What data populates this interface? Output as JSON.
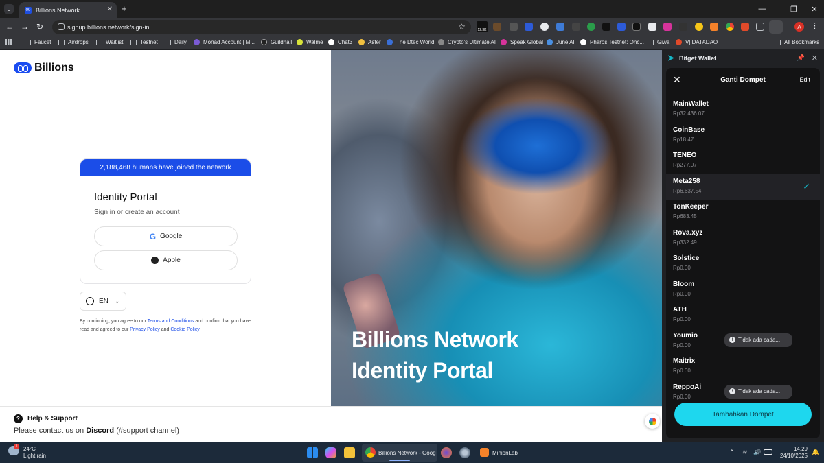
{
  "browser": {
    "tab": {
      "title": "Billions Network",
      "favicon": "00"
    },
    "url": "signup.billions.network/sign-in",
    "ext_badge": "12.3K",
    "profile_initial": "A",
    "bookmarks": [
      "Faucet",
      "Airdrops",
      "Waitlist",
      "Testnet",
      "Daily",
      "Monad Account | M...",
      "Guildhall",
      "Walme",
      "Chat3",
      "Aster",
      "The Dtec World",
      "Crypto's Ultimate AI",
      "Speak Global",
      "June AI",
      "Pharos Testnet: Onc...",
      "Giwa",
      "V| DATADAO"
    ],
    "all_bookmarks": "All Bookmarks"
  },
  "page": {
    "logo_text": "Billions",
    "banner": "2,188,468 humans have joined the network",
    "card_title": "Identity Portal",
    "card_subtitle": "Sign in or create an account",
    "google_label": "Google",
    "apple_label": "Apple",
    "lang": "EN",
    "terms": {
      "p1": "By continuing, you agree to our ",
      "link1": "Terms and Conditions",
      "p2": " and confirm that you have read and agreed to our ",
      "link2": "Privacy Policy",
      "p3": " and ",
      "link3": "Cookie Policy"
    },
    "hero_line1": "Billions Network",
    "hero_line2": "Identity Portal",
    "help_title": "Help & Support",
    "help_text_pre": "Please contact us on ",
    "help_link": "Discord",
    "help_text_post": " (#support channel)"
  },
  "wallet": {
    "panel_title": "Bitget Wallet",
    "header": "Ganti Dompet",
    "edit": "Edit",
    "accounts": [
      {
        "name": "MainWallet",
        "balance": "Rp32,436.07"
      },
      {
        "name": "CoinBase",
        "balance": "Rp18.47"
      },
      {
        "name": "TENEO",
        "balance": "Rp277.07"
      },
      {
        "name": "Meta258",
        "balance": "Rp6,637.54",
        "selected": true
      },
      {
        "name": "TonKeeper",
        "balance": "Rp683.45"
      },
      {
        "name": "Rova.xyz",
        "balance": "Rp332.49"
      },
      {
        "name": "Solstice",
        "balance": "Rp0.00"
      },
      {
        "name": "Bloom",
        "balance": "Rp0.00"
      },
      {
        "name": "ATH",
        "balance": "Rp0.00"
      },
      {
        "name": "Youmio",
        "balance": "Rp0.00",
        "tooltip": "Tidak ada cada..."
      },
      {
        "name": "Maitrix",
        "balance": "Rp0.00"
      },
      {
        "name": "ReppoAi",
        "balance": "Rp0.00",
        "tooltip": "Tidak ada cada..."
      }
    ],
    "add_button": "Tambahkan Dompet",
    "accent": "#1ed7ee"
  },
  "taskbar": {
    "temp": "24°C",
    "weather": "Light rain",
    "active_app": "Billions Network - Goog",
    "other_app": "MinionLab",
    "time": "14.29",
    "date": "24/10/2025"
  }
}
